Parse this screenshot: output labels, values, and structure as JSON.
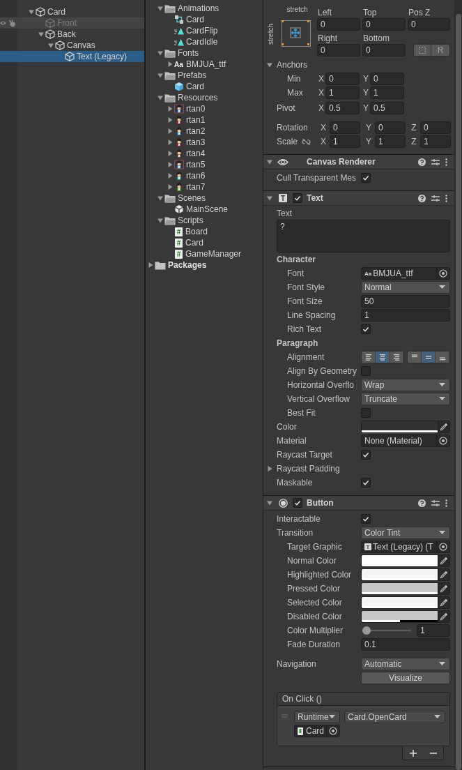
{
  "hierarchy": {
    "items": [
      {
        "name": "Card",
        "expanded": true,
        "selected": false,
        "disabled": false,
        "hovered": false,
        "children": [
          {
            "name": "Front",
            "selected": false,
            "disabled": true,
            "hovered": true
          },
          {
            "name": "Back",
            "expanded": true,
            "selected": false,
            "disabled": false,
            "hovered": false,
            "children": [
              {
                "name": "Canvas",
                "expanded": true,
                "selected": false,
                "disabled": false,
                "hovered": false,
                "children": [
                  {
                    "name": "Text (Legacy)",
                    "selected": true,
                    "disabled": false,
                    "hovered": false
                  }
                ]
              }
            ]
          }
        ]
      }
    ]
  },
  "project": {
    "items": [
      {
        "kind": "folder",
        "name": "Animations",
        "expanded": true,
        "children": [
          {
            "kind": "animator",
            "name": "Card"
          },
          {
            "kind": "clip",
            "name": "CardFlip"
          },
          {
            "kind": "clip",
            "name": "CardIdle"
          }
        ]
      },
      {
        "kind": "folder",
        "name": "Fonts",
        "expanded": true,
        "children": [
          {
            "kind": "font",
            "icon_text": "Aa",
            "name": "BMJUA_ttf",
            "expanded": false
          }
        ]
      },
      {
        "kind": "folder",
        "name": "Prefabs",
        "expanded": true,
        "children": [
          {
            "kind": "prefab",
            "name": "Card"
          }
        ]
      },
      {
        "kind": "folder",
        "name": "Resources",
        "expanded": true,
        "children": [
          {
            "kind": "sprite",
            "name": "rtan0",
            "expanded": false
          },
          {
            "kind": "sprite",
            "name": "rtan1",
            "expanded": false
          },
          {
            "kind": "sprite",
            "name": "rtan2",
            "expanded": false
          },
          {
            "kind": "sprite",
            "name": "rtan3",
            "expanded": false
          },
          {
            "kind": "sprite",
            "name": "rtan4",
            "expanded": false
          },
          {
            "kind": "sprite",
            "name": "rtan5",
            "expanded": false
          },
          {
            "kind": "sprite",
            "name": "rtan6",
            "expanded": false
          },
          {
            "kind": "sprite",
            "name": "rtan7",
            "expanded": false
          }
        ]
      },
      {
        "kind": "folder",
        "name": "Scenes",
        "expanded": true,
        "children": [
          {
            "kind": "scene",
            "name": "MainScene"
          }
        ]
      },
      {
        "kind": "folder",
        "name": "Scripts",
        "expanded": true,
        "children": [
          {
            "kind": "script",
            "icon_text": "#",
            "name": "Board"
          },
          {
            "kind": "script",
            "icon_text": "#",
            "name": "Card"
          },
          {
            "kind": "script",
            "icon_text": "#",
            "name": "GameManager"
          }
        ]
      },
      {
        "kind": "package_root",
        "name": "Packages",
        "expanded": false
      }
    ]
  },
  "inspector": {
    "rect_transform": {
      "anchor_x": "stretch",
      "anchor_y": "stretch",
      "offsets": [
        {
          "label": "Left",
          "value": "0"
        },
        {
          "label": "Top",
          "value": "0"
        },
        {
          "label": "Pos Z",
          "value": "0"
        },
        {
          "label": "Right",
          "value": "0"
        },
        {
          "label": "Bottom",
          "value": "0"
        }
      ],
      "reset_button": "R",
      "anchors": {
        "label": "Anchors",
        "expanded": true,
        "rows": [
          {
            "label": "Min",
            "fields": [
              {
                "axis": "X",
                "value": "0"
              },
              {
                "axis": "Y",
                "value": "0"
              }
            ]
          },
          {
            "label": "Max",
            "fields": [
              {
                "axis": "X",
                "value": "1"
              },
              {
                "axis": "Y",
                "value": "1"
              }
            ]
          }
        ]
      },
      "pivot": {
        "label": "Pivot",
        "fields": [
          {
            "axis": "X",
            "value": "0.5"
          },
          {
            "axis": "Y",
            "value": "0.5"
          }
        ]
      },
      "transform_rows": [
        {
          "label": "Rotation",
          "fields": [
            {
              "axis": "X",
              "value": "0"
            },
            {
              "axis": "Y",
              "value": "0"
            },
            {
              "axis": "Z",
              "value": "0"
            }
          ]
        },
        {
          "label": "Scale",
          "constrained": false,
          "fields": [
            {
              "axis": "X",
              "value": "1"
            },
            {
              "axis": "Y",
              "value": "1"
            },
            {
              "axis": "Z",
              "value": "1"
            }
          ]
        }
      ]
    },
    "components": [
      {
        "kind": "canvas_renderer",
        "title": "Canvas Renderer",
        "expanded": true,
        "rows": [
          {
            "kind": "check",
            "label": "Cull Transparent Mes",
            "checked": true
          }
        ]
      },
      {
        "kind": "text",
        "title": "Text",
        "icon_text": "T",
        "enabled": true,
        "expanded": true,
        "rows": [
          {
            "kind": "textarea",
            "label": "Text",
            "value": "?"
          },
          {
            "kind": "section",
            "label": "Character",
            "children": [
              {
                "kind": "object",
                "label": "Font",
                "icon_text": "Aa",
                "value": "BMJUA_ttf"
              },
              {
                "kind": "dropdown",
                "label": "Font Style",
                "value": "Normal"
              },
              {
                "kind": "field",
                "label": "Font Size",
                "value": "50"
              },
              {
                "kind": "field",
                "label": "Line Spacing",
                "value": "1"
              },
              {
                "kind": "check",
                "label": "Rich Text",
                "checked": true
              }
            ]
          },
          {
            "kind": "section",
            "label": "Paragraph",
            "children": [
              {
                "kind": "alignment",
                "label": "Alignment",
                "horizontal": [
                  {
                    "selected": false
                  },
                  {
                    "selected": true
                  },
                  {
                    "selected": false
                  }
                ],
                "vertical": [
                  {
                    "selected": false
                  },
                  {
                    "selected": true
                  },
                  {
                    "selected": false
                  }
                ]
              },
              {
                "kind": "check",
                "label": "Align By Geometry",
                "checked": false
              },
              {
                "kind": "dropdown",
                "label": "Horizontal Overflo",
                "value": "Wrap"
              },
              {
                "kind": "dropdown",
                "label": "Vertical Overflow",
                "value": "Truncate"
              },
              {
                "kind": "check",
                "label": "Best Fit",
                "checked": false
              }
            ]
          },
          {
            "kind": "color",
            "label": "Color",
            "color": "#323232",
            "level": 1
          },
          {
            "kind": "object",
            "label": "Material",
            "value": "None (Material)"
          },
          {
            "kind": "check",
            "label": "Raycast Target",
            "checked": true
          },
          {
            "kind": "foldout",
            "label": "Raycast Padding",
            "expanded": false
          },
          {
            "kind": "check",
            "label": "Maskable",
            "checked": true
          }
        ]
      },
      {
        "kind": "button",
        "title": "Button",
        "enabled": true,
        "expanded": true,
        "rows": [
          {
            "kind": "check",
            "label": "Interactable",
            "checked": true
          },
          {
            "kind": "dropdown",
            "label": "Transition",
            "value": "Color Tint",
            "children": [
              {
                "kind": "object",
                "label": "Target Graphic",
                "icon_text": "T",
                "value": "Text (Legacy) (T"
              },
              {
                "kind": "color",
                "label": "Normal Color",
                "color": "#ffffff",
                "level": 1
              },
              {
                "kind": "color",
                "label": "Highlighted Color",
                "color": "#f5f5f5",
                "level": 1
              },
              {
                "kind": "color",
                "label": "Pressed Color",
                "color": "#c8c8c8",
                "level": 1
              },
              {
                "kind": "color",
                "label": "Selected Color",
                "color": "#f5f5f5",
                "level": 1
              },
              {
                "kind": "color",
                "label": "Disabled Color",
                "color": "#c8c8c8",
                "level": 0.5
              },
              {
                "kind": "slider",
                "label": "Color Multiplier",
                "level": 0,
                "value": "1"
              },
              {
                "kind": "field",
                "label": "Fade Duration",
                "value": "0.1"
              }
            ]
          },
          {
            "kind": "dropdown",
            "label": "Navigation",
            "value": "Automatic"
          },
          {
            "kind": "action",
            "label": "Visualize"
          },
          {
            "kind": "event",
            "label": "On Click ()",
            "listeners": [
              {
                "mode": "Runtime",
                "function": "Card.OpenCard",
                "target": "Card"
              }
            ]
          }
        ]
      }
    ]
  }
}
